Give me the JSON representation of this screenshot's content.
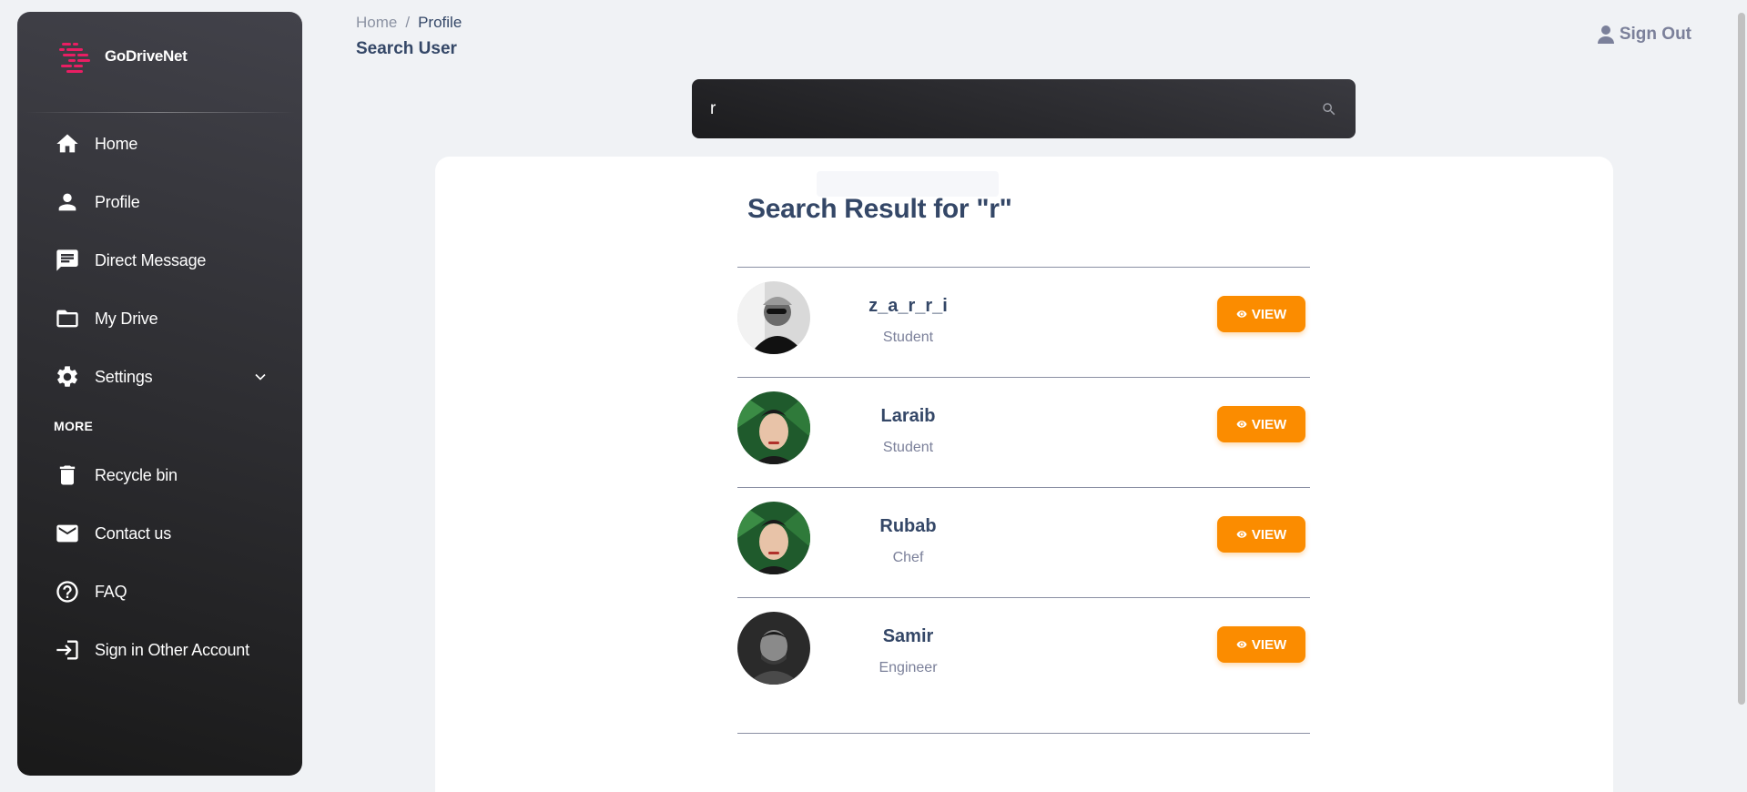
{
  "brand": {
    "name": "GoDriveNet",
    "logo_color": "#e91e63"
  },
  "sidebar": {
    "items": [
      {
        "label": "Home",
        "icon": "home-icon"
      },
      {
        "label": "Profile",
        "icon": "person-icon"
      },
      {
        "label": "Direct Message",
        "icon": "chat-icon"
      },
      {
        "label": "My Drive",
        "icon": "folder-icon"
      },
      {
        "label": "Settings",
        "icon": "gear-icon"
      }
    ],
    "section_more": "MORE",
    "more_items": [
      {
        "label": "Recycle bin",
        "icon": "trash-icon"
      },
      {
        "label": "Contact us",
        "icon": "mail-icon"
      },
      {
        "label": "FAQ",
        "icon": "help-icon"
      },
      {
        "label": "Sign in Other Account",
        "icon": "login-icon"
      }
    ]
  },
  "breadcrumb": {
    "home": "Home",
    "separator": "/",
    "current": "Profile"
  },
  "page_title": "Search User",
  "header": {
    "sign_out": "Sign Out"
  },
  "search": {
    "value": "r"
  },
  "results": {
    "title_prefix": "Search Result for \"",
    "query": "r",
    "title_suffix": "\"",
    "users": [
      {
        "name": "z_a_r_r_i",
        "role": "Student",
        "action": "VIEW"
      },
      {
        "name": "Laraib",
        "role": "Student",
        "action": "VIEW"
      },
      {
        "name": "Rubab",
        "role": "Chef",
        "action": "VIEW"
      },
      {
        "name": "Samir",
        "role": "Engineer",
        "action": "VIEW"
      }
    ]
  },
  "colors": {
    "accent": "#fb8c00",
    "text_dark": "#344767",
    "text_muted": "#7b809a"
  }
}
